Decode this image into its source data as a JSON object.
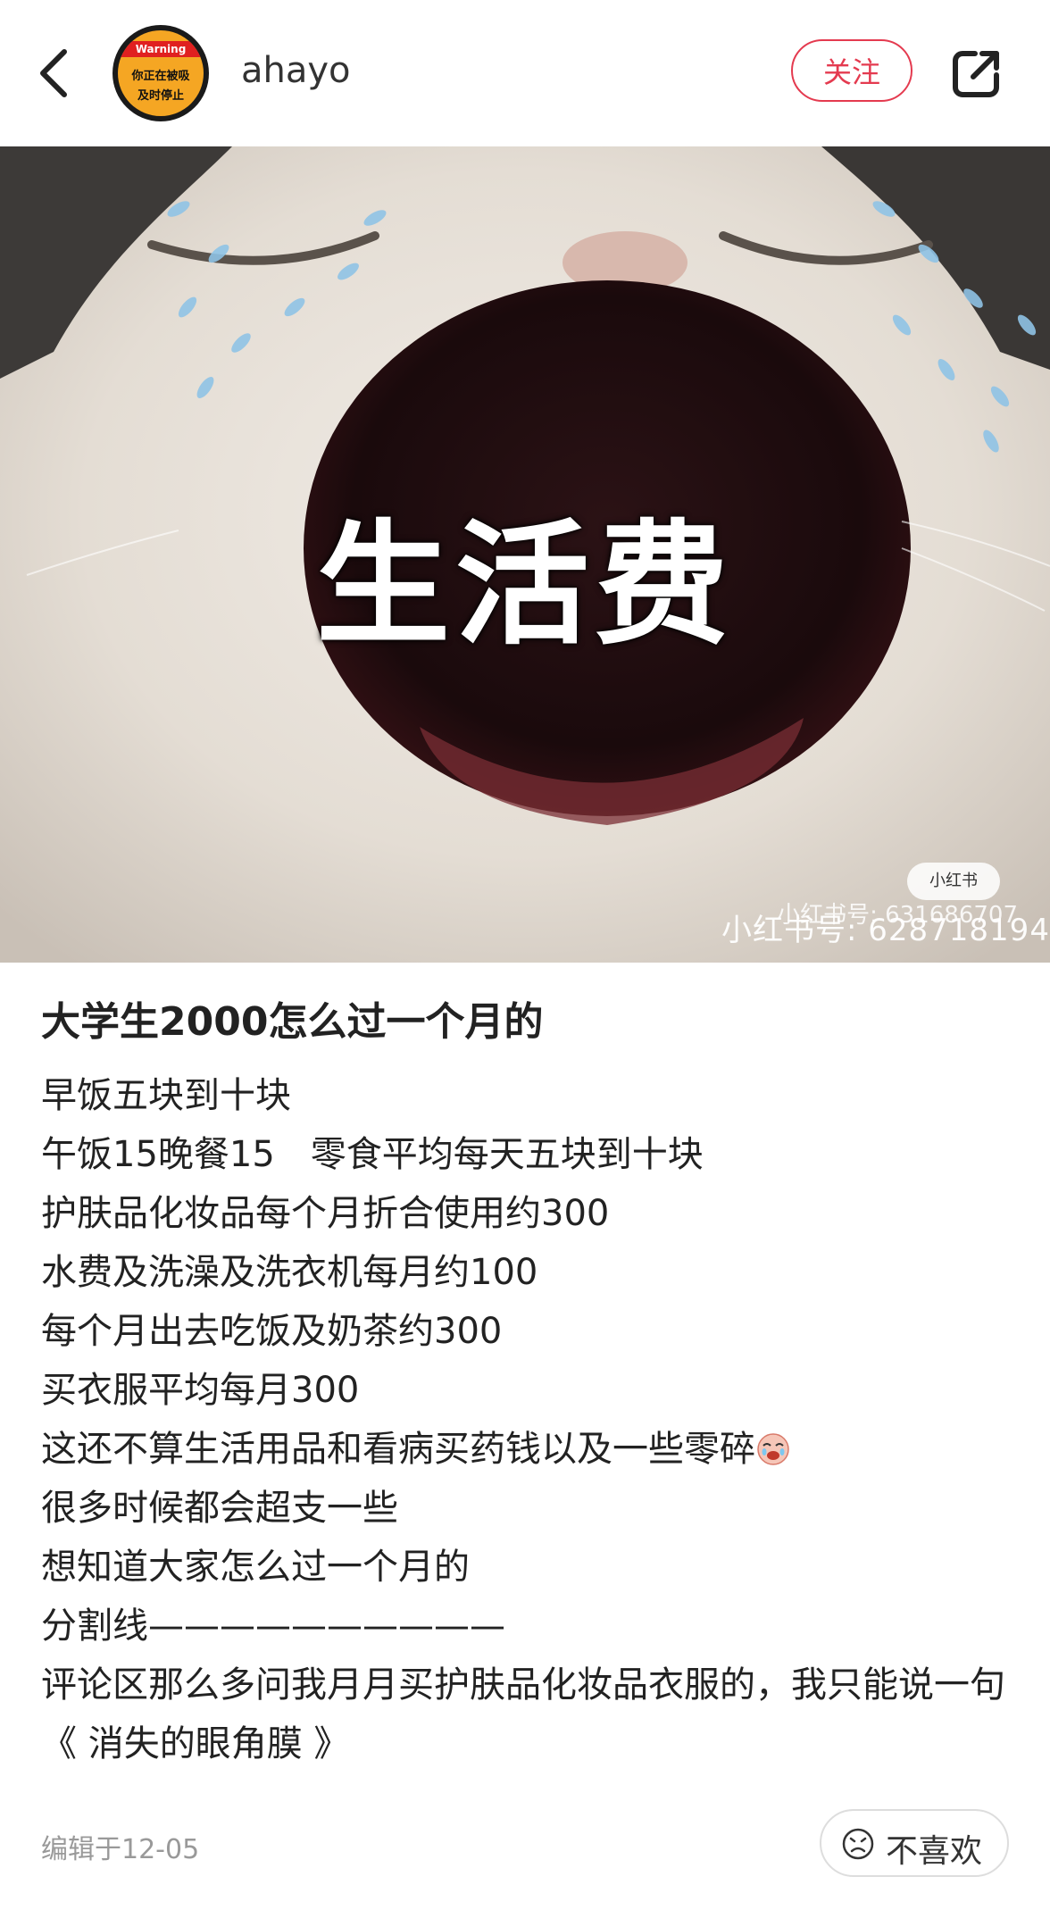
{
  "header": {
    "username": "ahayo",
    "follow_label": "关注",
    "avatar_text": {
      "warning": "Warning",
      "line1": "你正在被吸",
      "line2": "及时停止"
    }
  },
  "image": {
    "caption": "生活费",
    "watermark_top": "小红书号: 631686707",
    "watermark_bottom": "小红书号: 628718194",
    "watermark_logo": "小红书"
  },
  "post": {
    "title": "大学生2000怎么过一个月的",
    "lines": [
      "早饭五块到十块",
      "午饭15晚餐15　零食平均每天五块到十块",
      "护肤品化妆品每个月折合使用约300",
      "水费及洗澡及洗衣机每月约100",
      "每个月出去吃饭及奶茶约300",
      "买衣服平均每月300",
      "这还不算生活用品和看病买药钱以及一些零碎",
      "很多时候都会超支一些",
      "想知道大家怎么过一个月的",
      "分割线——————————",
      "评论区那么多问我月月买护肤品化妆品衣服的，我只能说一句《 消失的眼角膜 》"
    ],
    "edit_date": "编辑于12-05",
    "dislike_label": "不喜欢"
  },
  "icons": {
    "back": "chevron-left-icon",
    "share": "share-icon",
    "dislike": "sad-face-icon",
    "emoji": "crying-face-emoji"
  },
  "colors": {
    "accent": "#e43a4f",
    "text": "#222222",
    "muted": "#999999"
  }
}
